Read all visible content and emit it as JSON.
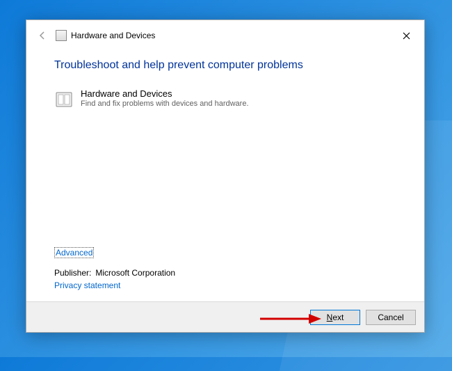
{
  "window": {
    "title": "Hardware and Devices"
  },
  "content": {
    "heading": "Troubleshoot and help prevent computer problems",
    "troubleshooter": {
      "name": "Hardware and Devices",
      "description": "Find and fix problems with devices and hardware."
    },
    "advanced_label": "Advanced",
    "publisher_label": "Publisher:",
    "publisher_value": "Microsoft Corporation",
    "privacy_label": "Privacy statement"
  },
  "buttons": {
    "next_prefix": "N",
    "next_rest": "ext",
    "cancel": "Cancel"
  },
  "colors": {
    "heading": "#003399",
    "link": "#0066cc",
    "accent": "#0078d7"
  }
}
